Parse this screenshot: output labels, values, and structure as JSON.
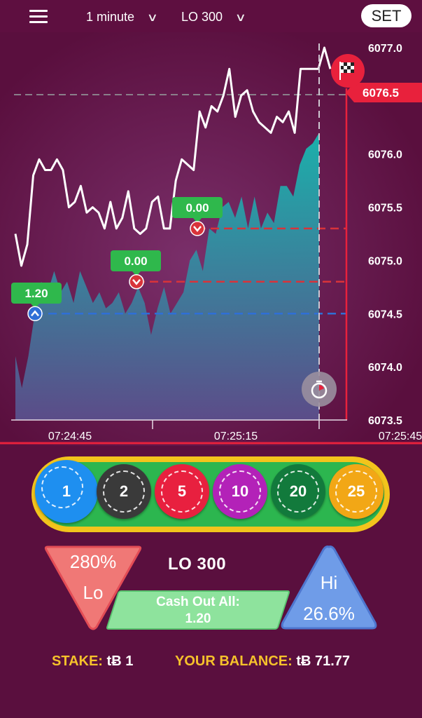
{
  "header": {
    "timeframe": "1 minute",
    "market": "LO 300",
    "set_label": "SET"
  },
  "chart": {
    "y_ticks": [
      "6077.0",
      "6076.0",
      "6075.5",
      "6075.0",
      "6074.5",
      "6074.0",
      "6073.5"
    ],
    "y_tick_values": [
      6077.0,
      6076.0,
      6075.5,
      6075.0,
      6074.5,
      6074.0,
      6073.5
    ],
    "x_ticks": [
      "07:24:45",
      "07:25:15",
      "07:25:45"
    ],
    "current_price": "6076.5",
    "markers": [
      {
        "label": "1.20",
        "direction": "up",
        "level": 6074.5
      },
      {
        "label": "0.00",
        "direction": "down",
        "level": 6074.8
      },
      {
        "label": "0.00",
        "direction": "down",
        "level": 6075.3
      }
    ]
  },
  "chart_data": {
    "type": "line",
    "ylim": [
      6073.5,
      6077.2
    ],
    "series": [
      {
        "values": [
          6075.25,
          6074.95,
          6075.15,
          6075.8,
          6075.95,
          6075.85,
          6075.85,
          6075.95,
          6075.85,
          6075.5,
          6075.55,
          6075.7,
          6075.45,
          6075.5,
          6075.45,
          6075.3,
          6075.55,
          6075.3,
          6075.4,
          6075.65,
          6075.3,
          6075.25,
          6075.3,
          6075.55,
          6075.6,
          6075.3,
          6075.3,
          6075.75,
          6075.95,
          6075.9,
          6075.85,
          6076.4,
          6076.25,
          6076.45,
          6076.4,
          6076.55,
          6076.8,
          6076.35,
          6076.55,
          6076.6,
          6076.4,
          6076.3,
          6076.25,
          6076.2,
          6076.35,
          6076.3,
          6076.4,
          6076.2,
          6076.8,
          6076.8,
          6076.8,
          6076.8,
          6077.0,
          6076.8
        ]
      },
      {
        "values": [
          6074.1,
          6073.8,
          6074.1,
          6074.5,
          6074.8,
          6074.7,
          6074.9,
          6074.7,
          6074.8,
          6074.6,
          6074.9,
          6074.75,
          6074.6,
          6074.7,
          6074.55,
          6074.6,
          6074.7,
          6074.5,
          6074.6,
          6074.75,
          6074.6,
          6074.3,
          6074.55,
          6074.75,
          6074.5,
          6074.6,
          6074.7,
          6075.0,
          6075.1,
          6074.9,
          6075.3,
          6075.25,
          6075.5,
          6075.55,
          6075.4,
          6075.6,
          6075.3,
          6075.6,
          6075.3,
          6075.45,
          6075.35,
          6075.7,
          6075.7,
          6075.6,
          6075.9,
          6076.05,
          6076.1,
          6076.2
        ]
      }
    ]
  },
  "chips": [
    {
      "label": "1",
      "color": "#1e8ff0"
    },
    {
      "label": "2",
      "color": "#3a3a3a"
    },
    {
      "label": "5",
      "color": "#e8203f"
    },
    {
      "label": "10",
      "color": "#b322b8"
    },
    {
      "label": "20",
      "color": "#127a3c"
    },
    {
      "label": "25",
      "color": "#f2a716"
    }
  ],
  "lo": {
    "percent": "280%",
    "label": "Lo"
  },
  "hi": {
    "label": "Hi",
    "percent": "26.6%"
  },
  "market_label": "LO 300",
  "cashout": {
    "line1": "Cash Out All:",
    "line2": "1.20"
  },
  "footer": {
    "stake_label": "STAKE:",
    "stake_value": "tɃ 1",
    "balance_label": "YOUR BALANCE:",
    "balance_value": "tɃ 71.77"
  },
  "colors": {
    "accent_red": "#e8213c",
    "area": "#1aa6a4",
    "hi_blue": "#6f9ce8",
    "lo_red": "#f07876"
  }
}
